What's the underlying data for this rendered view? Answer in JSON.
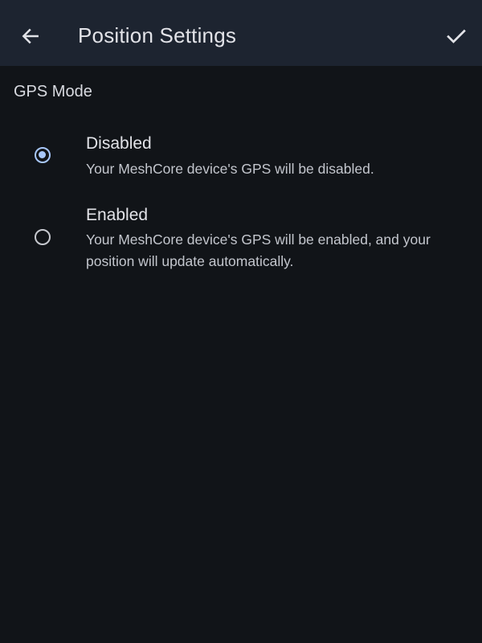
{
  "header": {
    "title": "Position Settings",
    "back_icon": "arrow-left-icon",
    "confirm_icon": "check-icon"
  },
  "gps_mode": {
    "label": "GPS Mode",
    "selected": "disabled",
    "options": [
      {
        "id": "disabled",
        "title": "Disabled",
        "description": "Your MeshCore device's GPS will be disabled."
      },
      {
        "id": "enabled",
        "title": "Enabled",
        "description": "Your MeshCore device's GPS will be enabled, and your position will update automatically."
      }
    ]
  },
  "colors": {
    "background": "#111418",
    "app_bar": "#1d2430",
    "accent": "#a8c7fa",
    "text_primary": "#e2e3e8",
    "text_secondary": "#c3c6cd"
  }
}
